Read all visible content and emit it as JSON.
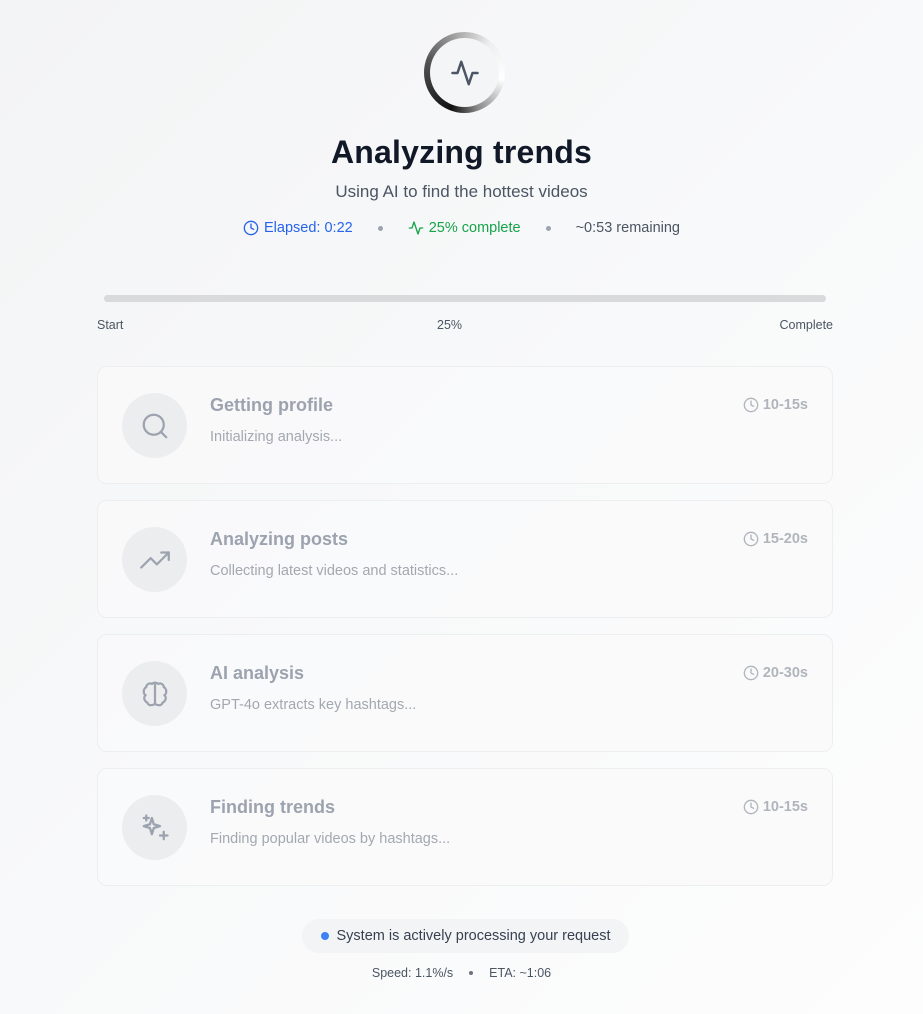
{
  "header": {
    "title": "Analyzing trends",
    "subtitle": "Using AI to find the hottest videos"
  },
  "stats": {
    "elapsed": "Elapsed: 0:22",
    "percent": "25% complete",
    "remaining": "~0:53 remaining"
  },
  "progress": {
    "value_percent": 25,
    "start_label": "Start",
    "mid_label": "25%",
    "end_label": "Complete"
  },
  "steps": [
    {
      "title": "Getting profile",
      "description": "Initializing analysis...",
      "time": "10-15s",
      "icon": "search-icon"
    },
    {
      "title": "Analyzing posts",
      "description": "Collecting latest videos and statistics...",
      "time": "15-20s",
      "icon": "trending-up-icon"
    },
    {
      "title": "AI analysis",
      "description": "GPT-4o extracts key hashtags...",
      "time": "20-30s",
      "icon": "brain-icon"
    },
    {
      "title": "Finding trends",
      "description": "Finding popular videos by hashtags...",
      "time": "10-15s",
      "icon": "sparkles-icon"
    }
  ],
  "status": {
    "message": "System is actively processing your request",
    "speed": "Speed: 1.1%/s",
    "eta": "ETA: ~1:06"
  },
  "colors": {
    "accent_blue": "#2563eb",
    "accent_green": "#16a34a",
    "status_dot": "#3b82f6"
  }
}
